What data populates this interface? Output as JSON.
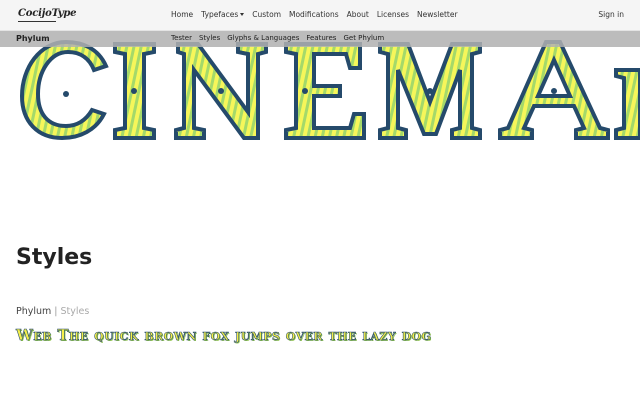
{
  "header": {
    "logo": "CocijoType",
    "nav": [
      {
        "label": "Home"
      },
      {
        "label": "Typefaces",
        "dropdown": true
      },
      {
        "label": "Custom"
      },
      {
        "label": "Modifications"
      },
      {
        "label": "About"
      },
      {
        "label": "Licenses"
      },
      {
        "label": "Newsletter"
      }
    ],
    "signin": "Sign in"
  },
  "subnav": {
    "brand": "Phylum",
    "links": [
      "Tester",
      "Styles",
      "Glyphs & Languages",
      "Features",
      "Get Phylum"
    ]
  },
  "hero": {
    "word": "CINEMA",
    "colors": {
      "outline": "#254a6b",
      "fill": "#f6f65a",
      "stripe": "#a4d96a"
    }
  },
  "styles": {
    "title": "Styles",
    "breadcrumb_family": "Phylum",
    "breadcrumb_sep": "|",
    "breadcrumb_section": "Styles",
    "sample_text": "Web  The quick brown fox jumps over the lazy dog"
  }
}
